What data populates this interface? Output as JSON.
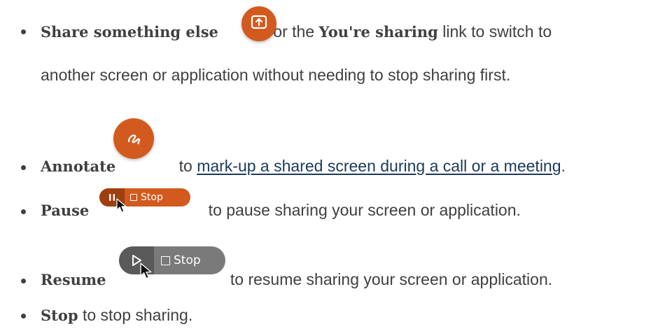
{
  "items": [
    {
      "term": "Share something else",
      "middle": " or the ",
      "term2": "You're sharing",
      "rest1": " link to switch to",
      "rest2": "another screen or application without needing to stop sharing first.",
      "icon": "share-screen-icon"
    },
    {
      "term": "Annotate",
      "before_link": " to ",
      "link_text": "mark-up a shared screen during a call or a meeting",
      "after_link": ".",
      "icon": "annotate-squiggle-icon"
    },
    {
      "term": "Pause",
      "text": " to pause sharing your screen or application.",
      "button_stop_label": "Stop",
      "icon": "pause-icon"
    },
    {
      "term": "Resume",
      "text": " to resume sharing your screen or application.",
      "button_stop_label": "Stop",
      "icon": "play-icon"
    },
    {
      "term": "Stop",
      "text": " to stop sharing."
    }
  ],
  "colors": {
    "text": "#404040",
    "accent_orange": "#d35a1e",
    "pause_bar_dark": "#9e3f10",
    "resume_bar_gray": "#7a7a7a",
    "resume_bar_dark": "#5a5a5a",
    "link": "#1b3a5c"
  }
}
